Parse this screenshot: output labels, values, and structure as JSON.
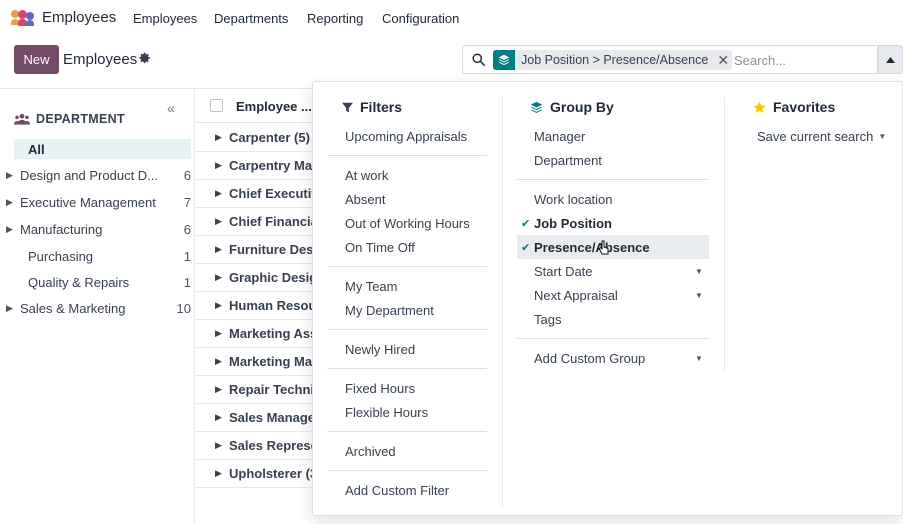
{
  "topnav": {
    "app_name": "Employees",
    "menu": [
      "Employees",
      "Departments",
      "Reporting",
      "Configuration"
    ]
  },
  "control": {
    "new_label": "New",
    "title": "Employees",
    "facet_text": "Job Position > Presence/Absence",
    "search_placeholder": "Search..."
  },
  "sidebar": {
    "header": "DEPARTMENT",
    "items": [
      {
        "label": "All",
        "count": "",
        "has_children": false,
        "active": true
      },
      {
        "label": "Design and Product D...",
        "count": "6",
        "has_children": true,
        "active": false
      },
      {
        "label": "Executive Management",
        "count": "7",
        "has_children": true,
        "active": false
      },
      {
        "label": "Manufacturing",
        "count": "6",
        "has_children": true,
        "active": false
      },
      {
        "label": "Purchasing",
        "count": "1",
        "has_children": false,
        "active": false
      },
      {
        "label": "Quality & Repairs",
        "count": "1",
        "has_children": false,
        "active": false
      },
      {
        "label": "Sales & Marketing",
        "count": "10",
        "has_children": true,
        "active": false
      }
    ]
  },
  "list": {
    "column": "Employee ...",
    "groups": [
      "Carpenter (5)",
      "Carpentry Mar",
      "Chief Executiv",
      "Chief Financia",
      "Furniture Desi",
      "Graphic Desig",
      "Human Resou",
      "Marketing Ass",
      "Marketing Mar",
      "Repair Technic",
      "Sales Manage",
      "Sales Represe",
      "Upholsterer (3"
    ]
  },
  "dropdown": {
    "filters": {
      "title": "Filters",
      "groups": [
        [
          "Upcoming Appraisals"
        ],
        [
          "At work",
          "Absent",
          "Out of Working Hours",
          "On Time Off"
        ],
        [
          "My Team",
          "My Department"
        ],
        [
          "Newly Hired"
        ],
        [
          "Fixed Hours",
          "Flexible Hours"
        ],
        [
          "Archived"
        ],
        [
          "Add Custom Filter"
        ]
      ]
    },
    "groupby": {
      "title": "Group By",
      "items": [
        "Manager",
        "Department",
        "Work location",
        "Job Position",
        "Presence/Absence",
        "Start Date",
        "Next Appraisal",
        "Tags",
        "Add Custom Group"
      ]
    },
    "favorites": {
      "title": "Favorites",
      "save_label": "Save current search"
    }
  },
  "colors": {
    "brand": "#714b67",
    "accent": "#017e84",
    "favorite_star": "#f3cc00"
  }
}
